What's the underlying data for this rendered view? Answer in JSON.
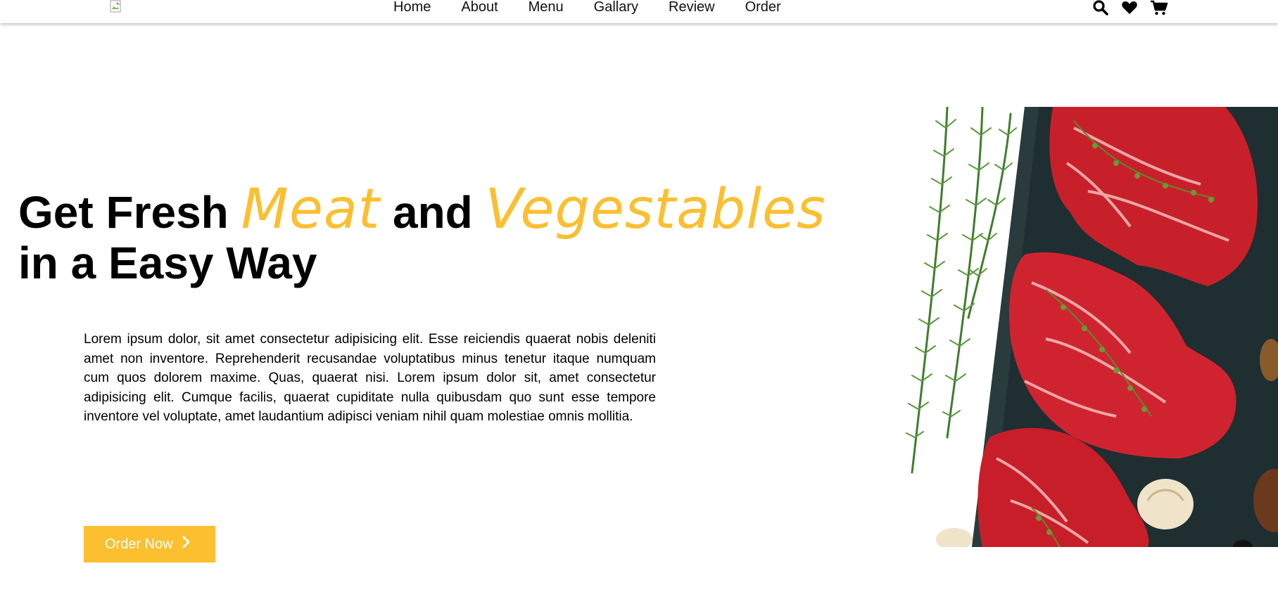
{
  "nav": {
    "links": [
      "Home",
      "About",
      "Menu",
      "Gallary",
      "Review",
      "Order"
    ],
    "icons": [
      "search-icon",
      "heart-icon",
      "cart-icon"
    ],
    "logo_icon": "broken-image-icon"
  },
  "hero": {
    "title_part1": "Get Fresh",
    "title_accent1": "Meat",
    "title_part2": "and",
    "title_accent2": "Vegestables",
    "title_line2": "in a Easy Way",
    "description": "Lorem ipsum dolor, sit amet consectetur adipisicing elit. Esse reiciendis quaerat nobis deleniti amet non inventore. Reprehenderit recusandae voluptatibus minus tenetur itaque numquam cum quos dolorem maxime. Quas, quaerat nisi. Lorem ipsum dolor sit, amet consectetur adipisicing elit. Cumque facilis, quaerat cupiditate nulla quibusdam quo sunt esse tempore inventore vel voluptate, amet laudantium adipisci veniam nihil quam molestiae omnis mollitia.",
    "button_label": "Order Now",
    "button_icon": "chevron-right-icon"
  },
  "colors": {
    "accent": "#fbbf2f",
    "text": "#000000",
    "slate": "#1f2e30",
    "meat": "#c8202b"
  }
}
